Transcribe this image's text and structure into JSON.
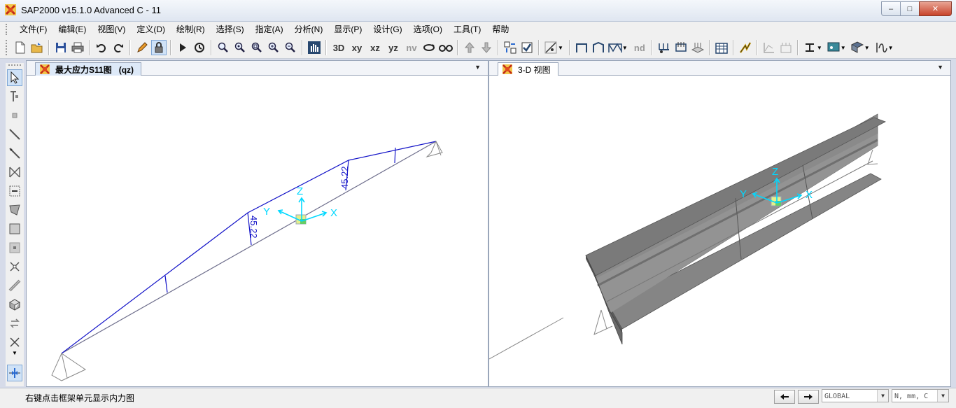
{
  "window": {
    "title": "SAP2000 v15.1.0 Advanced C  - 11",
    "minimize": "–",
    "maximize": "□",
    "close": "✕"
  },
  "menu": [
    "文件(F)",
    "编辑(E)",
    "视图(V)",
    "定义(D)",
    "绘制(R)",
    "选择(S)",
    "指定(A)",
    "分析(N)",
    "显示(P)",
    "设计(G)",
    "选项(O)",
    "工具(T)",
    "帮助"
  ],
  "toolbar": {
    "view_3d": "3D",
    "view_xy": "xy",
    "view_xz": "xz",
    "view_yz": "yz",
    "view_nv": "nv",
    "nd": "nd"
  },
  "left_panel": {
    "tab_label": "最大应力S11图   (qz)",
    "labels": [
      "45.22",
      "45.22"
    ],
    "axis": {
      "z": "Z",
      "y": "Y",
      "x": "X"
    }
  },
  "right_panel": {
    "tab_label": "3-D 视图",
    "axis": {
      "z": "Z",
      "y": "Y",
      "x": "X"
    }
  },
  "status": {
    "message": "右键点击框架单元显示内力图",
    "coord_system": "GLOBAL",
    "units": "N, mm, C"
  },
  "colors": {
    "diagram": "#1414c8",
    "axis": "#00e0ff",
    "member": "#6e6e8c",
    "beam_fill": "#8a8a8a"
  }
}
